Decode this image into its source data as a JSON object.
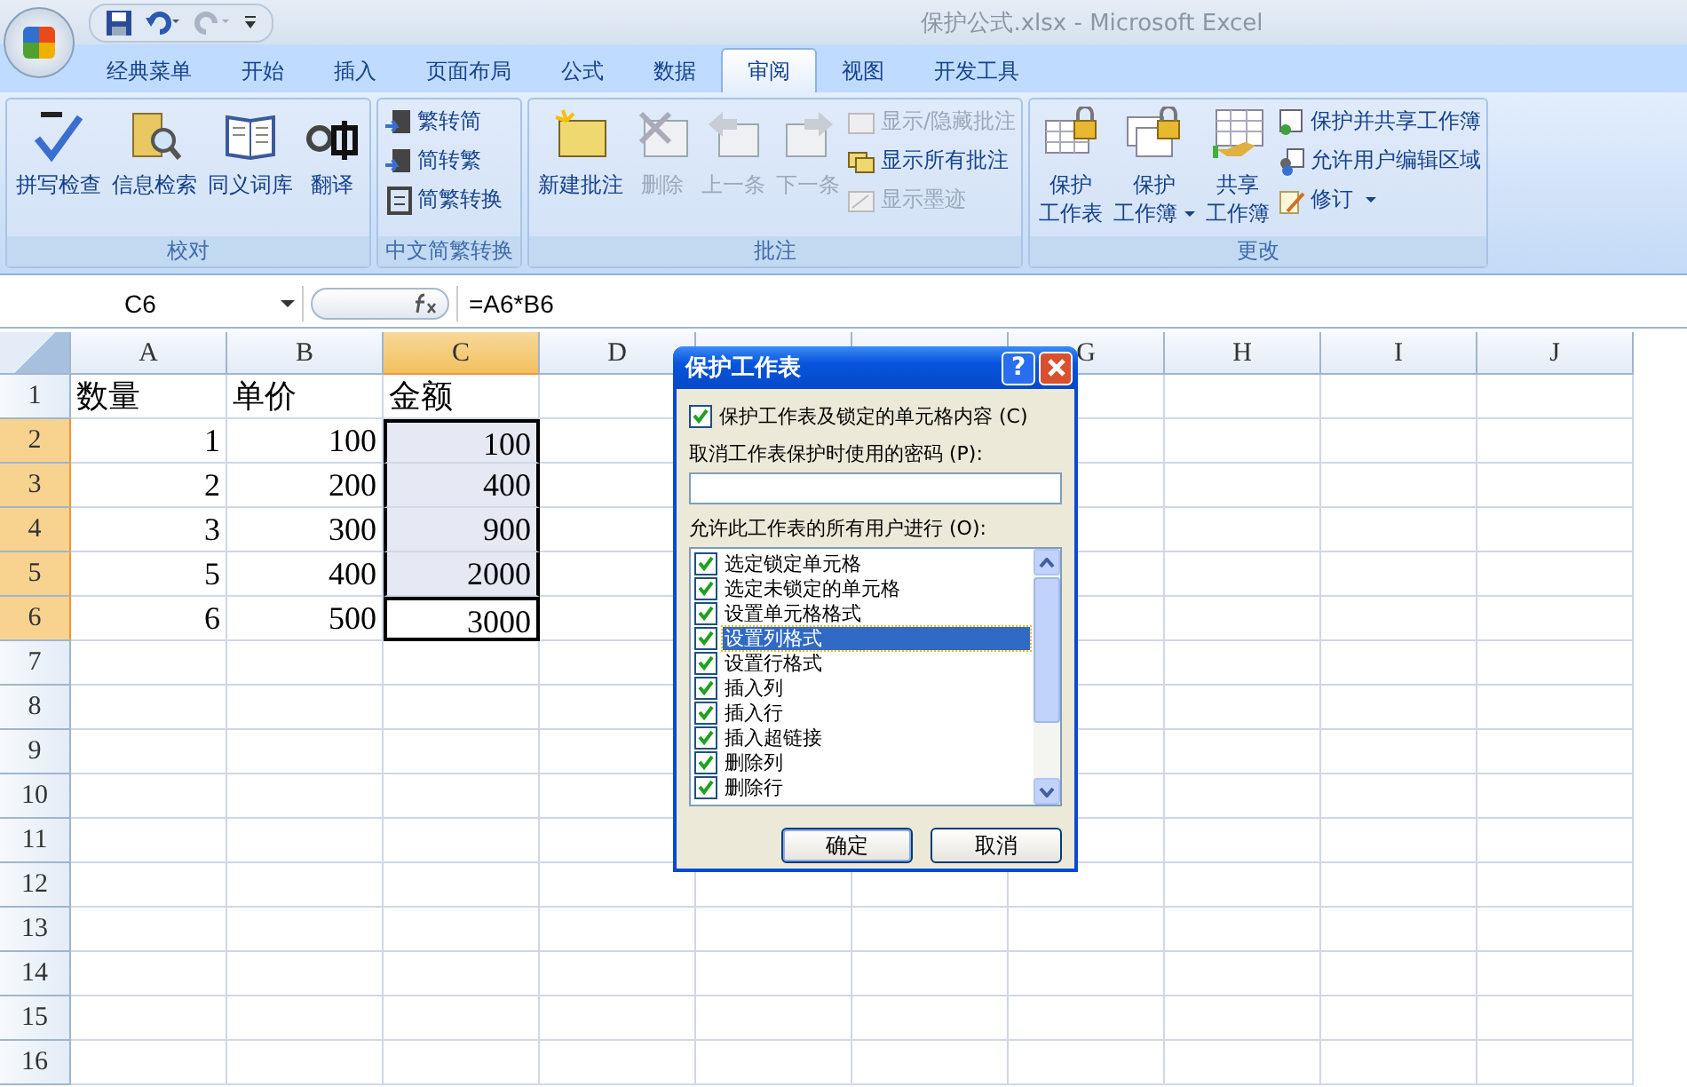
{
  "window": {
    "title": "保护公式.xlsx - Microsoft Excel"
  },
  "tabs": [
    {
      "label": "经典菜单",
      "selected": false
    },
    {
      "label": "开始",
      "selected": false
    },
    {
      "label": "插入",
      "selected": false
    },
    {
      "label": "页面布局",
      "selected": false
    },
    {
      "label": "公式",
      "selected": false
    },
    {
      "label": "数据",
      "selected": false
    },
    {
      "label": "审阅",
      "selected": true
    },
    {
      "label": "视图",
      "selected": false
    },
    {
      "label": "开发工具",
      "selected": false
    }
  ],
  "ribbon": [
    {
      "label": "校对",
      "buttons": [
        {
          "kind": "large",
          "label": "拼写检查",
          "disabled": false
        },
        {
          "kind": "large",
          "label": "信息检索",
          "disabled": false
        },
        {
          "kind": "large",
          "label": "同义词库",
          "disabled": false
        },
        {
          "kind": "large",
          "label": "翻译",
          "disabled": false
        }
      ]
    },
    {
      "label": "中文简繁转换",
      "buttons": [
        {
          "kind": "small",
          "label": "繁转简",
          "disabled": false
        },
        {
          "kind": "small",
          "label": "简转繁",
          "disabled": false
        },
        {
          "kind": "small",
          "label": "简繁转换",
          "disabled": false
        }
      ]
    },
    {
      "label": "批注",
      "buttons": [
        {
          "kind": "large",
          "label": "新建批注",
          "disabled": false
        },
        {
          "kind": "large",
          "label": "删除",
          "disabled": true
        },
        {
          "kind": "large",
          "label": "上一条",
          "disabled": true
        },
        {
          "kind": "large",
          "label": "下一条",
          "disabled": true
        },
        {
          "kind": "small",
          "label": "显示/隐藏批注",
          "disabled": true
        },
        {
          "kind": "small",
          "label": "显示所有批注",
          "disabled": false
        },
        {
          "kind": "small",
          "label": "显示墨迹",
          "disabled": true
        }
      ]
    },
    {
      "label": "更改",
      "buttons": [
        {
          "kind": "large",
          "label": "保护",
          "label_2": "工作表",
          "disabled": false
        },
        {
          "kind": "large",
          "label": "保护",
          "label_2": "工作簿",
          "disabled": false,
          "dropdown": true
        },
        {
          "kind": "large",
          "label": "共享",
          "label_2": "工作簿",
          "disabled": false
        },
        {
          "kind": "small",
          "label": "保护并共享工作簿",
          "disabled": false
        },
        {
          "kind": "small",
          "label": "允许用户编辑区域",
          "disabled": false
        },
        {
          "kind": "small",
          "label": "修订",
          "disabled": false,
          "dropdown": true
        }
      ]
    }
  ],
  "formula_bar": {
    "name_box": "C6",
    "formula": "=A6*B6"
  },
  "sheet": {
    "columns": [
      {
        "label": "A",
        "selected": false
      },
      {
        "label": "B",
        "selected": false
      },
      {
        "label": "C",
        "selected": true
      },
      {
        "label": "D",
        "selected": false
      },
      {
        "selected": false
      },
      {
        "selected": false
      },
      {
        "label": "G",
        "selected": false
      },
      {
        "label": "H",
        "selected": false
      },
      {
        "label": "I",
        "selected": false
      },
      {
        "label": "J",
        "selected": false
      }
    ],
    "rows": [
      {
        "label": "1",
        "kind": "text",
        "selected": false,
        "active": false,
        "cells": [
          "数量",
          "单价",
          "金额"
        ]
      },
      {
        "label": "2",
        "kind": "number",
        "selected": true,
        "active": false,
        "cells": [
          "1",
          "100",
          "100"
        ]
      },
      {
        "label": "3",
        "kind": "number",
        "selected": true,
        "active": false,
        "cells": [
          "2",
          "200",
          "400"
        ]
      },
      {
        "label": "4",
        "kind": "number",
        "selected": true,
        "active": false,
        "cells": [
          "3",
          "300",
          "900"
        ]
      },
      {
        "label": "5",
        "kind": "number",
        "selected": true,
        "active": false,
        "cells": [
          "5",
          "400",
          "2000"
        ]
      },
      {
        "label": "6",
        "kind": "number",
        "selected": true,
        "active": true,
        "cells": [
          "6",
          "500",
          "3000"
        ]
      },
      {
        "label": "7",
        "selected": false,
        "active": false
      },
      {
        "label": "8",
        "selected": false,
        "active": false
      },
      {
        "label": "9",
        "selected": false,
        "active": false
      },
      {
        "label": "10",
        "selected": false,
        "active": false
      },
      {
        "label": "11",
        "selected": false,
        "active": false
      },
      {
        "label": "12",
        "selected": false,
        "active": false
      },
      {
        "label": "13",
        "selected": false,
        "active": false
      },
      {
        "label": "14",
        "selected": false,
        "active": false
      },
      {
        "label": "15",
        "selected": false,
        "active": false
      },
      {
        "label": "16",
        "selected": false,
        "active": false
      }
    ]
  },
  "dialog": {
    "title": "保护工作表",
    "help": "?",
    "protect": {
      "label": "保护工作表及锁定的单元格内容 (C)",
      "checked": true
    },
    "password_label": "取消工作表保护时使用的密码 (P):",
    "list_label": "允许此工作表的所有用户进行 (O):",
    "items": [
      {
        "label": "选定锁定单元格",
        "checked": true,
        "selected": false
      },
      {
        "label": "选定未锁定的单元格",
        "checked": true,
        "selected": false
      },
      {
        "label": "设置单元格格式",
        "checked": true,
        "selected": false
      },
      {
        "label": "设置列格式",
        "checked": true,
        "selected": true
      },
      {
        "label": "设置行格式",
        "checked": true,
        "selected": false
      },
      {
        "label": "插入列",
        "checked": true,
        "selected": false
      },
      {
        "label": "插入行",
        "checked": true,
        "selected": false
      },
      {
        "label": "插入超链接",
        "checked": true,
        "selected": false
      },
      {
        "label": "删除列",
        "checked": true,
        "selected": false
      },
      {
        "label": "删除行",
        "checked": true,
        "selected": false
      }
    ],
    "buttons": [
      "确定",
      "取消"
    ]
  }
}
